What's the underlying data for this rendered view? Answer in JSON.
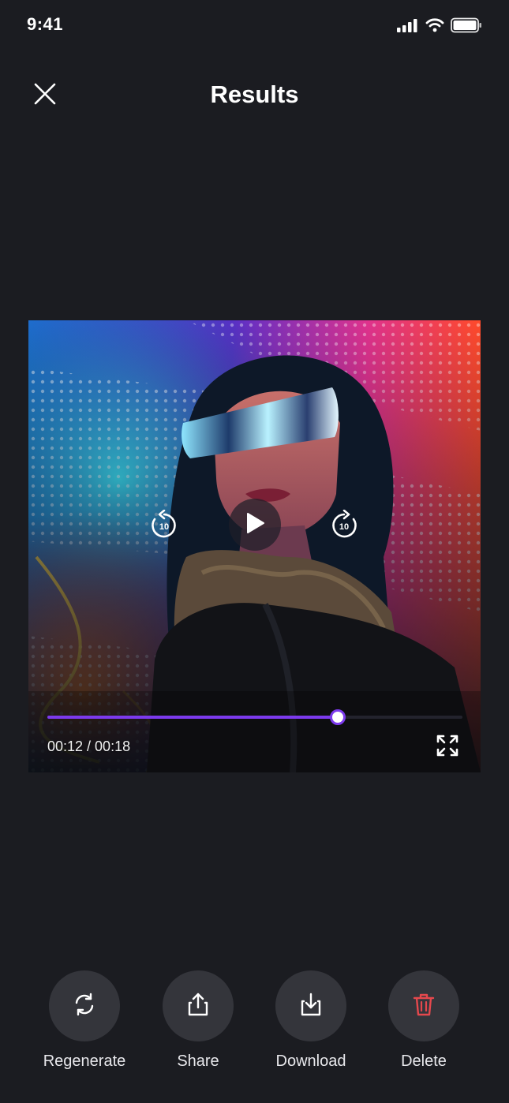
{
  "status_bar": {
    "time": "9:41",
    "icons": [
      "signal-icon",
      "wifi-icon",
      "battery-icon"
    ]
  },
  "header": {
    "title": "Results",
    "close_icon": "close-icon"
  },
  "player": {
    "current_time": "00:12 / 00:18",
    "progress": 0.7,
    "skip_back_label": "10",
    "skip_forward_label": "10",
    "accent_color": "#7c3aed",
    "icons": [
      "replay-10-icon",
      "play-icon",
      "forward-10-icon",
      "fullscreen-icon"
    ]
  },
  "actions": [
    {
      "label": "Regenerate",
      "icon": "regenerate-icon",
      "color": "#ffffff"
    },
    {
      "label": "Share",
      "icon": "share-icon",
      "color": "#ffffff"
    },
    {
      "label": "Download",
      "icon": "download-icon",
      "color": "#ffffff"
    },
    {
      "label": "Delete",
      "icon": "trash-icon",
      "color": "#e5484d"
    }
  ],
  "colors": {
    "background": "#1b1c21",
    "action_circle": "#34353b"
  }
}
